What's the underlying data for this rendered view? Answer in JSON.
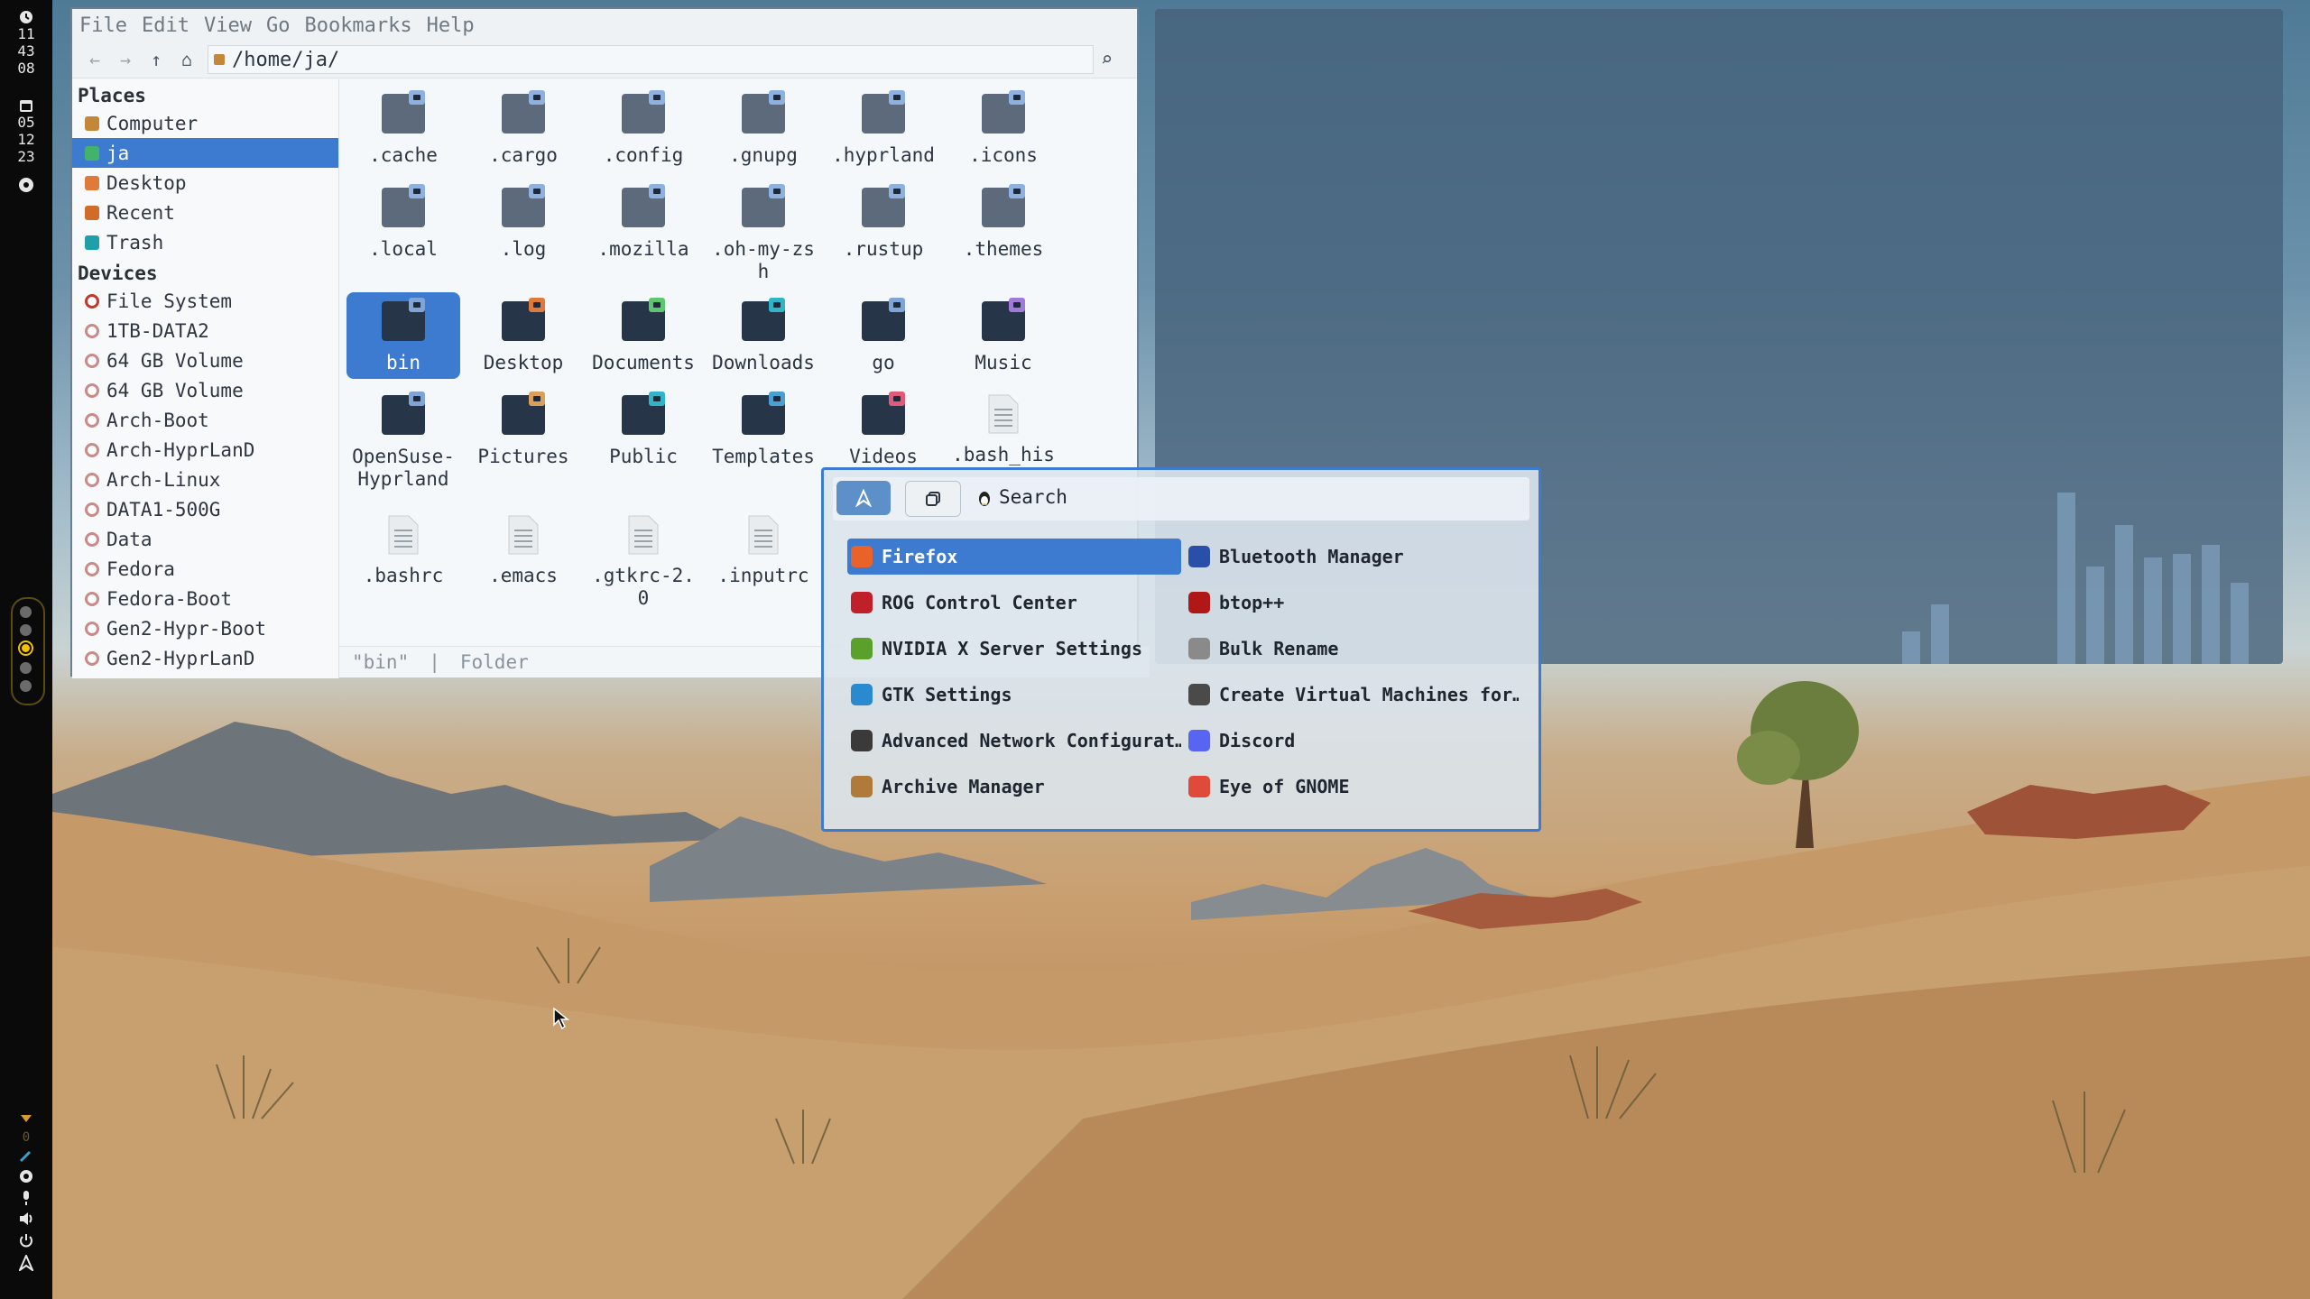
{
  "bar": {
    "clock": [
      "11",
      "43",
      "08"
    ],
    "date": [
      "05",
      "12",
      "23"
    ],
    "tray_indicator": "0"
  },
  "file_manager": {
    "menu": [
      "File",
      "Edit",
      "View",
      "Go",
      "Bookmarks",
      "Help"
    ],
    "path": "/home/ja/",
    "places_header": "Places",
    "places": [
      {
        "label": "Computer",
        "color": "#c4873a"
      },
      {
        "label": "ja",
        "color": "#41b36a"
      },
      {
        "label": "Desktop",
        "color": "#e07a3a"
      },
      {
        "label": "Recent",
        "color": "#d16b2a"
      },
      {
        "label": "Trash",
        "color": "#1fa0a8"
      }
    ],
    "devices_header": "Devices",
    "devices": [
      "File System",
      "1TB-DATA2",
      "64 GB Volume",
      "64 GB Volume",
      "Arch-Boot",
      "Arch-HyprLanD",
      "Arch-Linux",
      "DATA1-500G",
      "Data",
      "Fedora",
      "Fedora-Boot",
      "Gen2-Hypr-Boot",
      "Gen2-HyprLanD"
    ],
    "files": [
      {
        "name": ".cache",
        "kind": "folder",
        "badge": ""
      },
      {
        "name": ".cargo",
        "kind": "folder",
        "badge": ""
      },
      {
        "name": ".config",
        "kind": "folder",
        "badge": ""
      },
      {
        "name": ".gnupg",
        "kind": "folder",
        "badge": ""
      },
      {
        "name": ".hyprland",
        "kind": "folder",
        "badge": ""
      },
      {
        "name": ".icons",
        "kind": "folder",
        "badge": ""
      },
      {
        "name": ".local",
        "kind": "folder",
        "badge": ""
      },
      {
        "name": ".log",
        "kind": "folder",
        "badge": ""
      },
      {
        "name": ".mozilla",
        "kind": "folder",
        "badge": ""
      },
      {
        "name": ".oh-my-zsh",
        "kind": "folder",
        "badge": ""
      },
      {
        "name": ".rustup",
        "kind": "folder",
        "badge": ""
      },
      {
        "name": ".themes",
        "kind": "folder",
        "badge": ""
      },
      {
        "name": "bin",
        "kind": "folder-dark",
        "badge": "#7ea4d8"
      },
      {
        "name": "Desktop",
        "kind": "folder-dark",
        "badge": "#e07a3a"
      },
      {
        "name": "Documents",
        "kind": "folder-dark",
        "badge": "#5cc76e"
      },
      {
        "name": "Downloads",
        "kind": "folder-dark",
        "badge": "#2fb4c8"
      },
      {
        "name": "go",
        "kind": "folder-dark",
        "badge": "#7ea4d8"
      },
      {
        "name": "Music",
        "kind": "folder-dark",
        "badge": "#a07ad8"
      },
      {
        "name": "OpenSuse-Hyprland",
        "kind": "folder-dark",
        "badge": "#7ea4d8"
      },
      {
        "name": "Pictures",
        "kind": "folder-dark",
        "badge": "#d8a05a"
      },
      {
        "name": "Public",
        "kind": "folder-dark",
        "badge": "#2fb4c8"
      },
      {
        "name": "Templates",
        "kind": "folder-dark",
        "badge": "#4aa0d0"
      },
      {
        "name": "Videos",
        "kind": "folder-dark",
        "badge": "#e05a7a"
      },
      {
        "name": ".bash_his",
        "kind": "doc",
        "badge": ""
      },
      {
        "name": ".bashrc",
        "kind": "doc",
        "badge": ""
      },
      {
        "name": ".emacs",
        "kind": "doc",
        "badge": ""
      },
      {
        "name": ".gtkrc-2.0",
        "kind": "doc",
        "badge": ""
      },
      {
        "name": ".inputrc",
        "kind": "doc",
        "badge": ""
      }
    ],
    "status": {
      "selected": "\"bin\"",
      "separator": "|",
      "type": "Folder"
    }
  },
  "launcher": {
    "search_placeholder": "Search",
    "apps": [
      {
        "label": "Firefox",
        "color": "#e8622a"
      },
      {
        "label": "Bluetooth Manager",
        "color": "#2a4fa8"
      },
      {
        "label": "ROG Control Center",
        "color": "#c0202a"
      },
      {
        "label": "btop++",
        "color": "#b01818"
      },
      {
        "label": "NVIDIA X Server Settings",
        "color": "#5aa02a"
      },
      {
        "label": "Bulk Rename",
        "color": "#8a8a8a"
      },
      {
        "label": "GTK Settings",
        "color": "#2a8ad0"
      },
      {
        "label": "Create Virtual Machines for…",
        "color": "#4a4a4a"
      },
      {
        "label": "Advanced Network Configurat…",
        "color": "#3a3a3a"
      },
      {
        "label": "Discord",
        "color": "#5865f2"
      },
      {
        "label": "Archive Manager",
        "color": "#b07a3a"
      },
      {
        "label": "Eye of GNOME",
        "color": "#e04a3a"
      }
    ]
  }
}
